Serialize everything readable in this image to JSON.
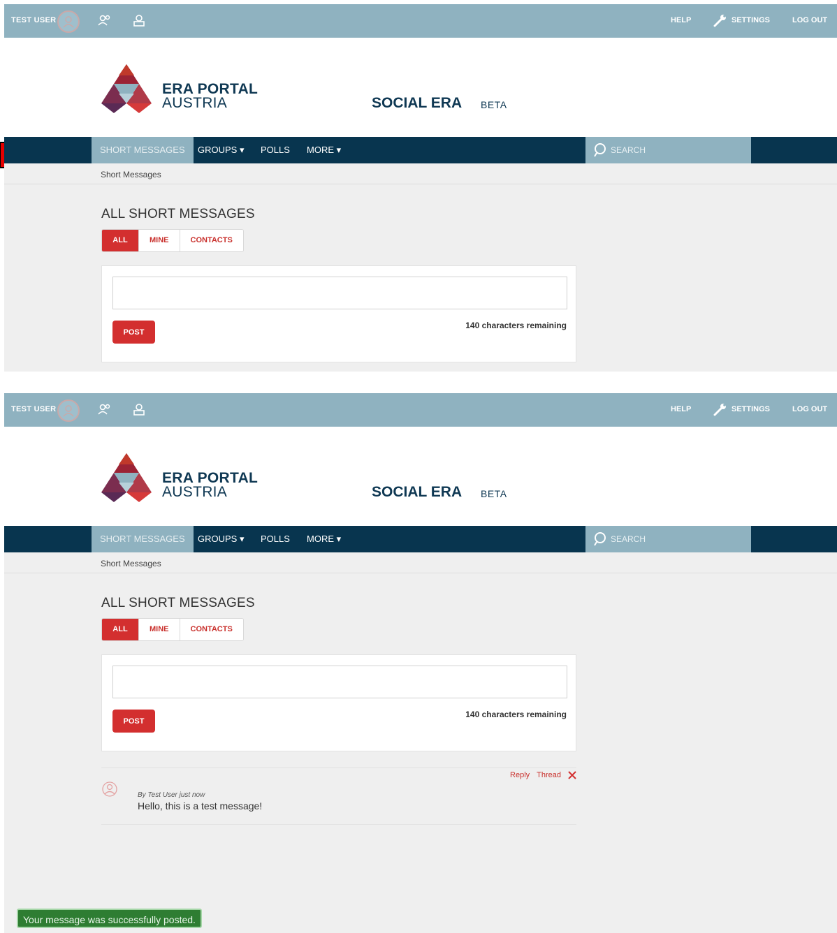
{
  "colors": {
    "topbar": "#8fb2c0",
    "navbar": "#08354f",
    "accent_red": "#d32f2f",
    "success_green": "#2e7d32",
    "brand_text": "#0f3853"
  },
  "topbar": {
    "user_name": "TEST USER",
    "help_label": "HELP",
    "settings_label": "SETTINGS",
    "logout_label": "LOG OUT",
    "icons": [
      "user-avatar-icon",
      "contacts-icon",
      "messages-icon",
      "wrench-icon"
    ]
  },
  "header": {
    "brand_line1": "ERA PORTAL",
    "brand_line2": "AUSTRIA",
    "app_title": "SOCIAL ERA",
    "app_badge": "BETA"
  },
  "nav": {
    "items": [
      {
        "label": "SHORT MESSAGES",
        "active": true
      },
      {
        "label": "GROUPS ▾",
        "active": false
      },
      {
        "label": "POLLS",
        "active": false
      },
      {
        "label": "MORE ▾",
        "active": false
      }
    ],
    "search_placeholder": "SEARCH"
  },
  "breadcrumb": "Short Messages",
  "main": {
    "title": "ALL SHORT MESSAGES",
    "filters": [
      {
        "label": "ALL",
        "active": true
      },
      {
        "label": "MINE",
        "active": false
      },
      {
        "label": "CONTACTS",
        "active": false
      }
    ],
    "compose_value": "",
    "post_label": "POST",
    "counter": "140 characters remaining"
  },
  "message": {
    "meta": "By Test User just now",
    "text": "Hello, this is a test message!",
    "reply_label": "Reply",
    "thread_label": "Thread",
    "delete_icon": "close-x-icon"
  },
  "toast": "Your message was successfully posted."
}
